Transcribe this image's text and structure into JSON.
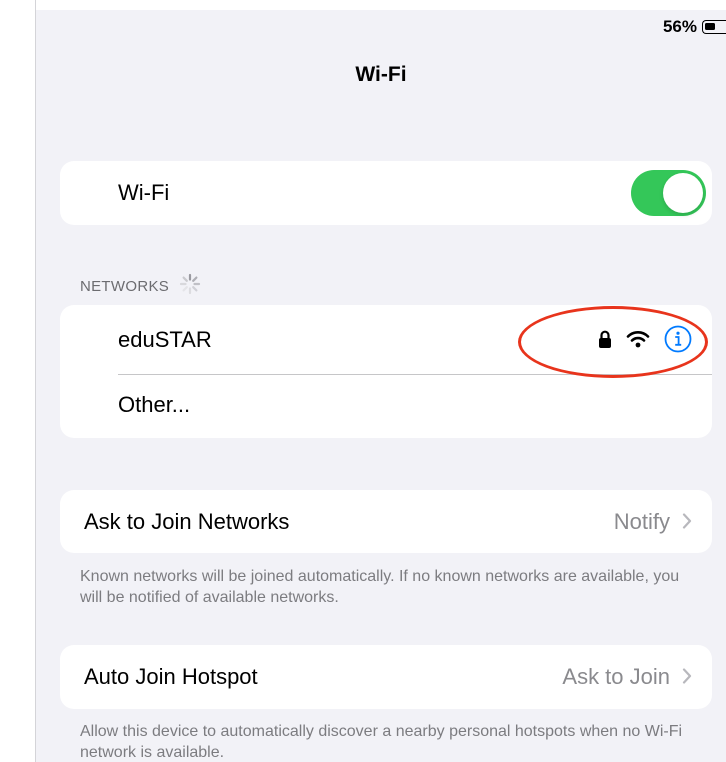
{
  "status_bar": {
    "battery_percent": "56%",
    "battery_level": 0.56
  },
  "header": {
    "title": "Wi-Fi"
  },
  "wifi_card": {
    "label": "Wi-Fi",
    "toggle_on": true,
    "toggle_color": "#34c759"
  },
  "networks_section": {
    "header": "NETWORKS",
    "loading": true,
    "items": [
      {
        "name": "eduSTAR",
        "secured": true,
        "icons": [
          "lock-icon",
          "wifi-signal-icon",
          "info-icon"
        ]
      },
      {
        "name": "Other..."
      }
    ]
  },
  "ask_to_join": {
    "label": "Ask to Join Networks",
    "value": "Notify",
    "footnote": "Known networks will be joined automatically. If no known networks are available, you will be notified of available networks."
  },
  "auto_join_hotspot": {
    "label": "Auto Join Hotspot",
    "value": "Ask to Join",
    "footnote": "Allow this device to automatically discover a nearby personal hotspots when no Wi-Fi network is available."
  },
  "colors": {
    "accent_blue": "#007aff",
    "annotation_red": "#e8341c",
    "background": "#f2f2f7"
  }
}
